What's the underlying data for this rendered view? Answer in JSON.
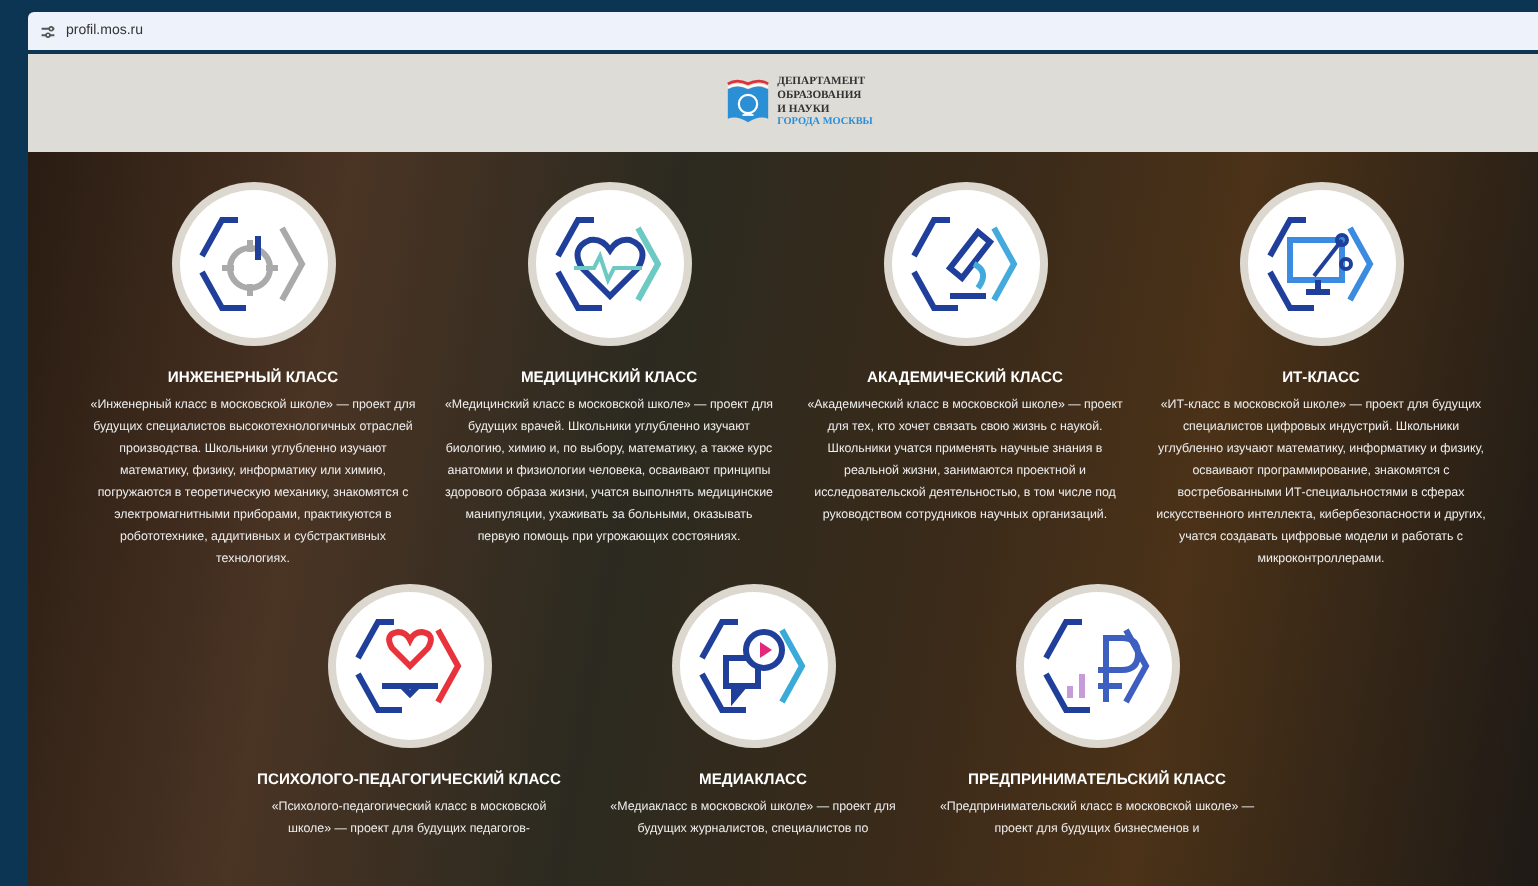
{
  "address_bar": {
    "url": "profil.mos.ru"
  },
  "logo": {
    "lines": [
      "ДЕПАРТАМЕНТ",
      "ОБРАЗОВАНИЯ",
      "И НАУКИ"
    ],
    "subline": "ГОРОДА МОСКВЫ"
  },
  "rows": [
    {
      "classes": [
        {
          "kind": "gear",
          "title": "ИНЖЕНЕРНЫЙ КЛАСС",
          "text": "«Инженерный класс в московской школе» — проект для будущих специалистов высокотехнологичных отраслей производства. Школьники углубленно изучают математику, физику, информатику или химию, погружаются в теоретическую механику, знакомятся с электромагнитными приборами, практикуются в робототехнике, аддитивных и субстрактивных технологиях."
        },
        {
          "kind": "heart",
          "title": "МЕДИЦИНСКИЙ КЛАСС",
          "text": "«Медицинский класс в московской школе» — проект для будущих врачей. Школьники углубленно изучают биологию, химию и, по выбору, математику, а также курс анатомии и физиологии человека, осваивают принципы здорового образа жизни, учатся выполнять медицинские манипуляции, ухаживать за больными, оказывать первую помощь при угрожающих состояниях."
        },
        {
          "kind": "microscope",
          "title": "АКАДЕМИЧЕСКИЙ КЛАСС",
          "text": "«Академический класс в московской школе» — проект для тех, кто хочет связать свою жизнь с наукой. Школьники учатся применять научные знания в реальной жизни, занимаются проектной и исследовательской деятельностью, в том числе под руководством сотрудников научных организаций."
        },
        {
          "kind": "monitor",
          "title": "ИТ-КЛАСС",
          "text": "«ИТ-класс в московской школе» — проект для будущих специалистов цифровых индустрий. Школьники углубленно изучают математику, информатику и физику, осваивают программирование, знакомятся с востребованными ИТ-специальностями в сферах искусственного интеллекта, кибербезопасности и других, учатся создавать цифровые модели и работать с микроконтроллерами."
        }
      ]
    },
    {
      "classes": [
        {
          "kind": "book-heart",
          "title": "ПСИХОЛОГО-ПЕДАГОГИЧЕСКИЙ КЛАСС",
          "text": "«Психолого-педагогический класс в московской школе» — проект для будущих педагогов-"
        },
        {
          "kind": "media",
          "title": "МЕДИАКЛАСС",
          "text": "«Медиакласс в московской школе» — проект для будущих журналистов, специалистов по"
        },
        {
          "kind": "ruble",
          "title": "ПРЕДПРИНИМАТЕЛЬСКИЙ КЛАСС",
          "text": "«Предпринимательский класс в московской школе» — проект для будущих бизнесменов и"
        }
      ]
    }
  ]
}
